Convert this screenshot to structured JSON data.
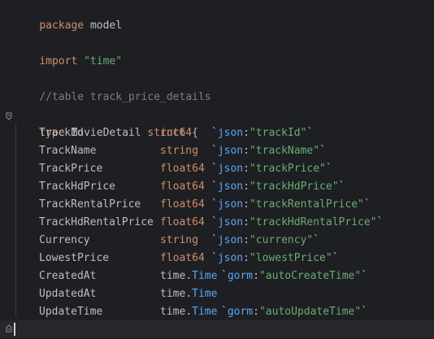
{
  "code": {
    "package_kw": "package",
    "package_name": "model",
    "import_kw": "import",
    "import_path": "\"time\"",
    "comment": "//table track_price_details",
    "type_kw": "type",
    "struct_name": "MovieDetail",
    "struct_kw": "struct",
    "open_brace": "{",
    "close_brace": "}",
    "fields": [
      {
        "name": "TrackId",
        "type": "int64",
        "tag_key": "json",
        "tag_val": "\"trackId\""
      },
      {
        "name": "TrackName",
        "type": "string",
        "tag_key": "json",
        "tag_val": "\"trackName\""
      },
      {
        "name": "TrackPrice",
        "type": "float64",
        "tag_key": "json",
        "tag_val": "\"trackPrice\""
      },
      {
        "name": "TrackHdPrice",
        "type": "float64",
        "tag_key": "json",
        "tag_val": "\"trackHdPrice\""
      },
      {
        "name": "TrackRentalPrice",
        "type": "float64",
        "tag_key": "json",
        "tag_val": "\"trackRentalPrice\""
      },
      {
        "name": "TrackHdRentalPrice",
        "type": "float64",
        "tag_key": "json",
        "tag_val": "\"trackHdRentalPrice\""
      },
      {
        "name": "Currency",
        "type": "string",
        "tag_key": "json",
        "tag_val": "\"currency\""
      },
      {
        "name": "LowestPrice",
        "type": "float64",
        "tag_key": "json",
        "tag_val": "\"lowestPrice\""
      },
      {
        "name": "CreatedAt",
        "type_pkg": "time",
        "type_name": "Time",
        "tag_key": "gorm",
        "tag_val": "\"autoCreateTime\""
      },
      {
        "name": "UpdatedAt",
        "type_pkg": "time",
        "type_name": "Time"
      },
      {
        "name": "UpdateTime",
        "type_pkg": "time",
        "type_name": "Time",
        "tag_key": "gorm",
        "tag_val": "\"autoUpdateTime\""
      }
    ]
  },
  "colors": {
    "background": "#1e1f22",
    "keyword": "#cf8e6d",
    "string": "#6aab73",
    "comment": "#7a7e85",
    "tag_key": "#56a8f5",
    "text": "#bcbec4"
  },
  "icons": {
    "fold_open": "fold-open-icon",
    "fold_close": "fold-close-icon"
  }
}
